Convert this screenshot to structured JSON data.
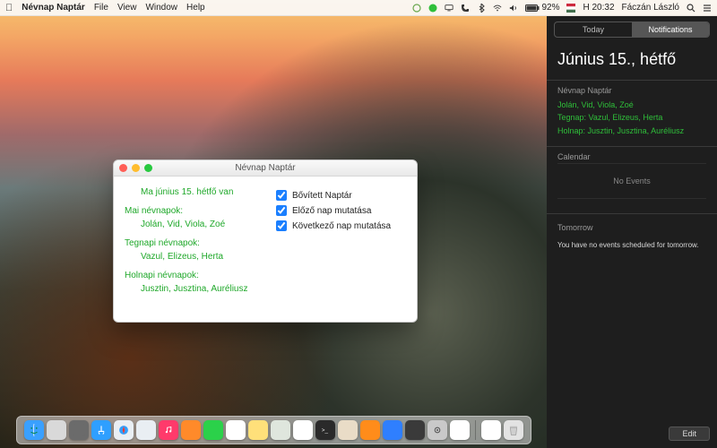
{
  "menubar": {
    "app_name": "Névnap Naptár",
    "menus": [
      "File",
      "View",
      "Window",
      "Help"
    ],
    "right": {
      "battery_pct": "92%",
      "clock": "H 20:32",
      "user": "Fáczán László"
    }
  },
  "notification_center": {
    "tabs": {
      "today": "Today",
      "notifications": "Notifications"
    },
    "date": "Június 15., hétfő",
    "widget_title": "Névnap Naptár",
    "names_today": "Jolán, Vid, Viola, Zoé",
    "names_yesterday_label": "Tegnap:",
    "names_yesterday": "Vazul, Elizeus, Herta",
    "names_tomorrow_label": "Holnap:",
    "names_tomorrow": "Jusztin, Jusztina, Auréliusz",
    "calendar_title": "Calendar",
    "no_events": "No Events",
    "tomorrow_title": "Tomorrow",
    "tomorrow_text": "You have no events scheduled for tomorrow.",
    "edit": "Edit"
  },
  "window": {
    "title": "Névnap Naptár",
    "today_line": "Ma június 15. hétfő van",
    "sections": {
      "today_label": "Mai névnapok:",
      "today_names": "Jolán, Vid, Viola, Zoé",
      "yesterday_label": "Tegnapi névnapok:",
      "yesterday_names": "Vazul, Elizeus, Herta",
      "tomorrow_label": "Holnapi névnapok:",
      "tomorrow_names": "Jusztin, Jusztina, Auréliusz"
    },
    "options": {
      "extended_calendar": "Bővített Naptár",
      "show_previous": "Előző nap mutatása",
      "show_next": "Következő nap mutatása"
    }
  },
  "dock": {
    "apps": [
      {
        "name": "finder",
        "bg": "#3aa0ff"
      },
      {
        "name": "launchpad",
        "bg": "#d9d9d9"
      },
      {
        "name": "mission-control",
        "bg": "#6b6b6b"
      },
      {
        "name": "app-store",
        "bg": "#2f9fff"
      },
      {
        "name": "safari",
        "bg": "#e9eef3"
      },
      {
        "name": "mail",
        "bg": "#e9eef3"
      },
      {
        "name": "itunes",
        "bg": "#ff3a6b"
      },
      {
        "name": "ibooks",
        "bg": "#ff8a2a"
      },
      {
        "name": "messages",
        "bg": "#2bd14a"
      },
      {
        "name": "reminders",
        "bg": "#ffffff"
      },
      {
        "name": "notes",
        "bg": "#ffe07a"
      },
      {
        "name": "maps",
        "bg": "#dfe6dd"
      },
      {
        "name": "photos",
        "bg": "#ffffff"
      },
      {
        "name": "terminal",
        "bg": "#2a2a2a"
      },
      {
        "name": "gimp",
        "bg": "#e9dcc7"
      },
      {
        "name": "vlc",
        "bg": "#ff8c1a"
      },
      {
        "name": "xcode",
        "bg": "#2f7fff"
      },
      {
        "name": "iphoto",
        "bg": "#3a3a3a"
      },
      {
        "name": "preferences",
        "bg": "#c9c9c9"
      },
      {
        "name": "nevnap-naptar",
        "bg": "#ffffff"
      }
    ],
    "right_apps": [
      {
        "name": "pages",
        "bg": "#ffffff"
      },
      {
        "name": "trash",
        "bg": "#e3e3e3"
      }
    ]
  }
}
